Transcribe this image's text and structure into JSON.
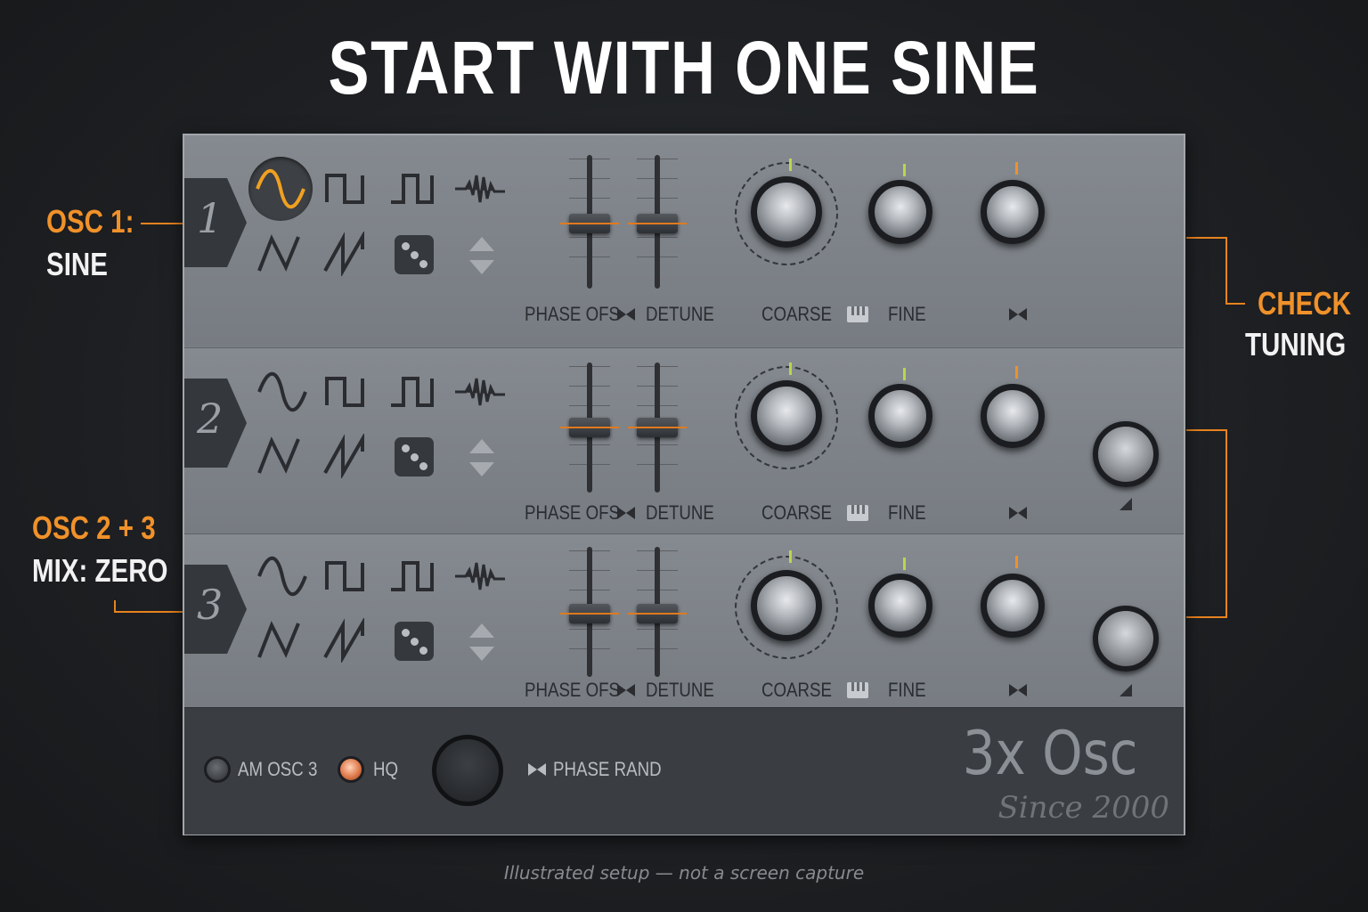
{
  "heading": "START WITH ONE SINE",
  "callouts": {
    "osc1_title": "OSC 1:",
    "osc1_value": "SINE",
    "osc23_title": "OSC 2 + 3",
    "osc23_value": "MIX: ZERO",
    "check_title": "CHECK",
    "check_value": "TUNING"
  },
  "oscillators": [
    {
      "number": "1",
      "selected_wave": "sine",
      "labels": {
        "phase": "PHASE OFS",
        "detune": "DETUNE",
        "coarse": "COARSE",
        "fine": "FINE"
      }
    },
    {
      "number": "2",
      "selected_wave": "none",
      "labels": {
        "phase": "PHASE OFS",
        "detune": "DETUNE",
        "coarse": "COARSE",
        "fine": "FINE"
      }
    },
    {
      "number": "3",
      "selected_wave": "none",
      "labels": {
        "phase": "PHASE OFS",
        "detune": "DETUNE",
        "coarse": "COARSE",
        "fine": "FINE"
      }
    }
  ],
  "wave_icons": [
    "sine-icon",
    "square-icon",
    "pulse-icon",
    "noise-icon",
    "triangle-icon",
    "saw-icon",
    "dice-icon",
    "arrows-icon"
  ],
  "bottom": {
    "am_label": "AM OSC 3",
    "hq_label": "HQ",
    "phase_rand_label": "PHASE RAND",
    "am_on": false,
    "hq_on": true
  },
  "logo": {
    "name": "3x Osc",
    "tagline": "Since 2000"
  },
  "caption": "Illustrated setup — not a screen capture",
  "colors": {
    "accent": "#f0912a",
    "green_marker": "#b9d64a",
    "panel": "#7c8187",
    "bottom_bar": "#3a3d41"
  }
}
